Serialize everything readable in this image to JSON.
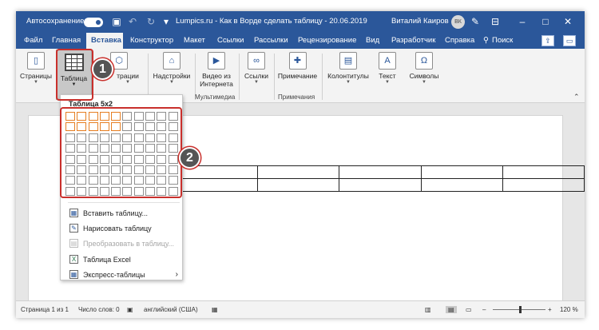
{
  "titlebar": {
    "autosave_label": "Автосохранение",
    "doc_title": "Lumpics.ru - Как в Ворде сделать таблицу - 20.06.2019",
    "user_name": "Виталий Каиров",
    "user_initials": "ВК"
  },
  "menu": {
    "tabs": [
      "Файл",
      "Главная",
      "Вставка",
      "Конструктор",
      "Макет",
      "Ссылки",
      "Рассылки",
      "Рецензирование",
      "Вид",
      "Разработчик",
      "Справка"
    ],
    "search": "Поиск"
  },
  "ribbon": {
    "pages": "Страницы",
    "table": "Таблица",
    "illustrations": "трации",
    "addins": "Надстройки",
    "online_video_line1": "Видео из",
    "online_video_line2": "Интернета",
    "links": "Ссылки",
    "comment": "Примечание",
    "header_footer": "Колонтитулы",
    "text": "Текст",
    "symbols": "Символы",
    "group_media": "Мультимедиа",
    "group_comments": "Примечания"
  },
  "dropdown": {
    "title": "Таблица 5x2",
    "selected_cols": 5,
    "selected_rows": 2,
    "grid_cols": 10,
    "grid_rows": 8,
    "items": [
      {
        "label": "Вставить таблицу...",
        "icon": "insert-table-icon",
        "disabled": false
      },
      {
        "label": "Нарисовать таблицу",
        "icon": "draw-table-icon",
        "disabled": false
      },
      {
        "label": "Преобразовать в таблицу...",
        "icon": "convert-table-icon",
        "disabled": true
      },
      {
        "label": "Таблица Excel",
        "icon": "excel-table-icon",
        "disabled": false
      },
      {
        "label": "Экспресс-таблицы",
        "icon": "quick-tables-icon",
        "disabled": false
      }
    ]
  },
  "annotations": {
    "step1": "1",
    "step2": "2"
  },
  "status": {
    "page": "Страница 1 из 1",
    "words": "Число слов: 0",
    "language": "английский (США)",
    "zoom": "120 %"
  },
  "colors": {
    "accent": "#2b579a",
    "highlight": "#c9302c",
    "selection": "#e67e22"
  }
}
